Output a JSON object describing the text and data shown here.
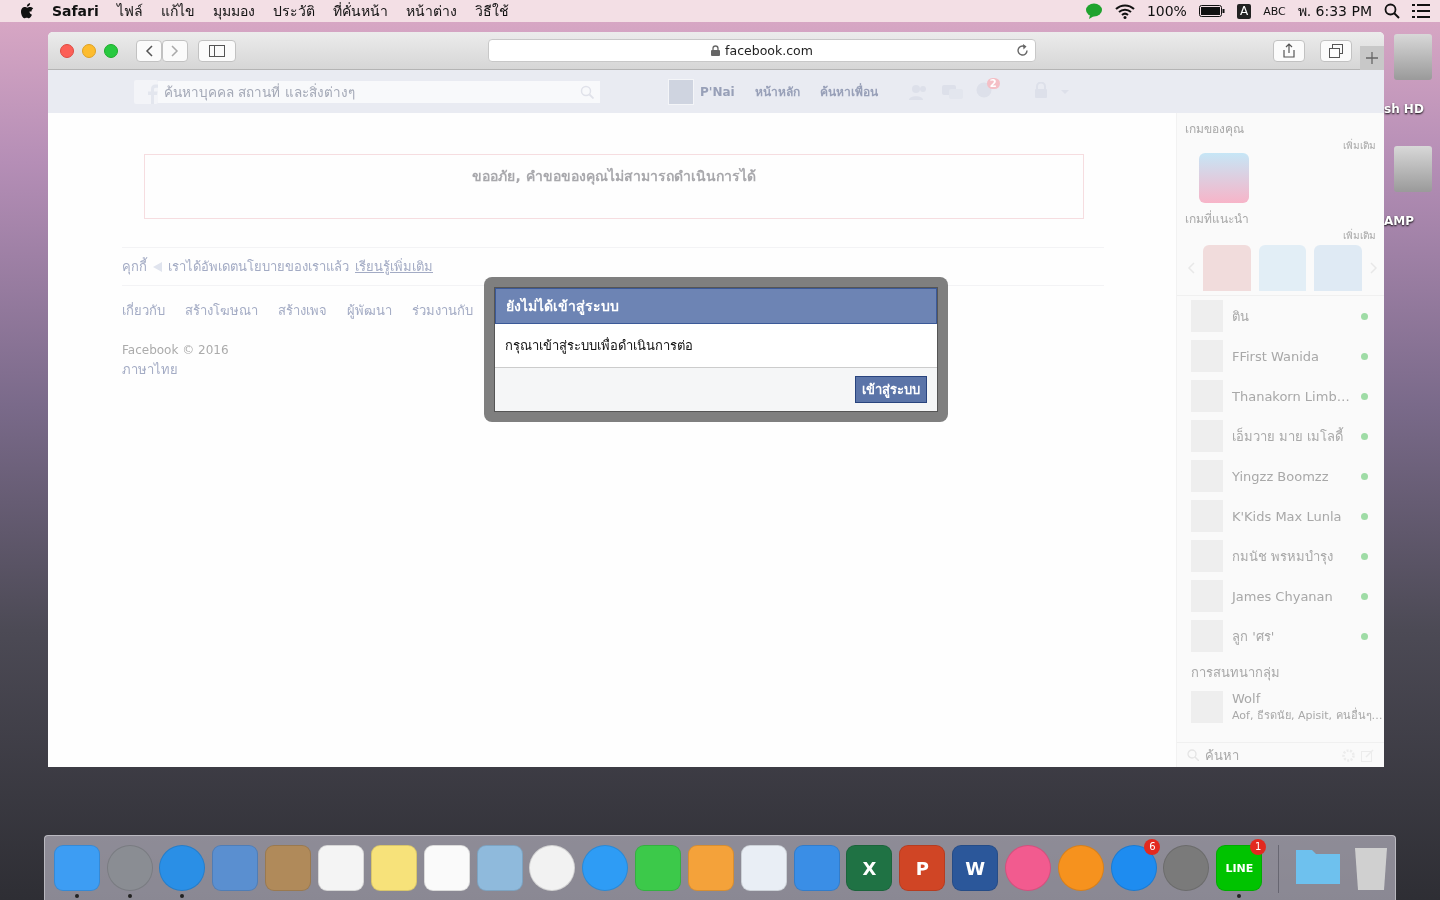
{
  "menu_bar": {
    "app": "Safari",
    "menus": [
      "ไฟล์",
      "แก้ไข",
      "มุมมอง",
      "ประวัติ",
      "ที่คั่นหน้า",
      "หน้าต่าง",
      "วิธีใช้"
    ],
    "battery": "100%",
    "input_source_icon": "A",
    "input_source": "ABC",
    "clock": "พ. 6:33 PM"
  },
  "desktop_icons": [
    {
      "label": "sh HD"
    },
    {
      "label": "AMP"
    }
  ],
  "browser": {
    "address": "facebook.com"
  },
  "facebook": {
    "search_placeholder": "ค้นหาบุคคล สถานที่ และสิ่งต่างๆ",
    "profile_name": "P'Nai",
    "nav": [
      "หน้าหลัก",
      "ค้นหาเพื่อน"
    ],
    "notification_count": "2",
    "error_title": "ขออภัย, คำขอของคุณไม่สามารถดำเนินการได้",
    "cookie_label": "คุกกี้",
    "cookie_text": "เราได้อัพเดตนโยบายของเราแล้ว",
    "cookie_link": "เรียนรู้เพิ่มเติม",
    "footer_links": [
      "เกี่ยวกับ",
      "สร้างโฆษณา",
      "สร้างเพจ",
      "ผู้พัฒนา",
      "ร่วมงานกับ"
    ],
    "copyright": "Facebook © 2016",
    "language": "ภาษาไทย"
  },
  "sidebar": {
    "your_games_title": "เกมของคุณ",
    "your_games_more": "เพิ่มเติม",
    "suggested_title": "เกมที่แนะนำ",
    "suggested_more": "เพิ่มเติม",
    "contacts": [
      {
        "name": "ติน",
        "online": true
      },
      {
        "name": "FFirst Wanida",
        "online": true
      },
      {
        "name": "Thanakorn Limb…",
        "online": true
      },
      {
        "name": "เอ็มวาย มาย เมโลดี้",
        "online": true
      },
      {
        "name": "Yingzz Boomzz",
        "online": true
      },
      {
        "name": "K'Kids Max Lunla",
        "online": true
      },
      {
        "name": "กมนัช พรหมบำรุง",
        "online": true
      },
      {
        "name": "James Chyanan",
        "online": true
      },
      {
        "name": "ลูก 'ศร'",
        "online": true
      }
    ],
    "group_chats_title": "การสนทนากลุ่ม",
    "group_chats": [
      {
        "name": "Wolf",
        "members": "Aof, ธีรดนัย, Apisit, คนอื่นๆ…"
      }
    ],
    "search_placeholder": "ค้นหา"
  },
  "dialog": {
    "title": "ยังไม่ได้เข้าสู่ระบบ",
    "message": "กรุณาเข้าสู่ระบบเพื่อดำเนินการต่อ",
    "button": "เข้าสู่ระบบ"
  },
  "dock": {
    "items": [
      {
        "kind": "app",
        "color": "#3d9df3",
        "running": true
      },
      {
        "kind": "round",
        "color": "#8a8d93",
        "running": true
      },
      {
        "kind": "round",
        "color": "#2a8fe6",
        "running": true
      },
      {
        "kind": "app",
        "color": "#5a8fd0",
        "running": false
      },
      {
        "kind": "app",
        "color": "#b08a5a",
        "running": false
      },
      {
        "kind": "app",
        "color": "#f4f4f4",
        "running": false
      },
      {
        "kind": "app",
        "color": "#f7e27a",
        "running": false
      },
      {
        "kind": "app",
        "color": "#fafafa",
        "running": false
      },
      {
        "kind": "app",
        "color": "#8fbadc",
        "running": false
      },
      {
        "kind": "round",
        "color": "#f2f2f2",
        "running": false
      },
      {
        "kind": "round",
        "color": "#2e9cf5",
        "running": false
      },
      {
        "kind": "app",
        "color": "#3cc94a",
        "running": false
      },
      {
        "kind": "app",
        "color": "#f4a23a",
        "running": false
      },
      {
        "kind": "app",
        "color": "#e9eef5",
        "running": false
      },
      {
        "kind": "app",
        "color": "#3a8ee6",
        "running": false
      },
      {
        "kind": "app",
        "color": "#1f7244",
        "glyph": "X",
        "running": false
      },
      {
        "kind": "app",
        "color": "#d04525",
        "glyph": "P",
        "running": false
      },
      {
        "kind": "app",
        "color": "#2b579a",
        "glyph": "W",
        "running": false
      },
      {
        "kind": "round",
        "color": "#f25b8f",
        "running": false
      },
      {
        "kind": "round",
        "color": "#f6921e",
        "running": false
      },
      {
        "kind": "round",
        "color": "#1e8cf0",
        "badge": "6",
        "running": false
      },
      {
        "kind": "round",
        "color": "#7a7a7a",
        "running": false
      },
      {
        "kind": "app",
        "color": "#00c300",
        "glyph": "LINE",
        "badge": "1",
        "running": true
      }
    ],
    "stacks": [
      {
        "kind": "folder",
        "color": "#6ec1ee",
        "running": false
      },
      {
        "kind": "trash",
        "color": "#d0d0d0",
        "running": false
      }
    ]
  }
}
